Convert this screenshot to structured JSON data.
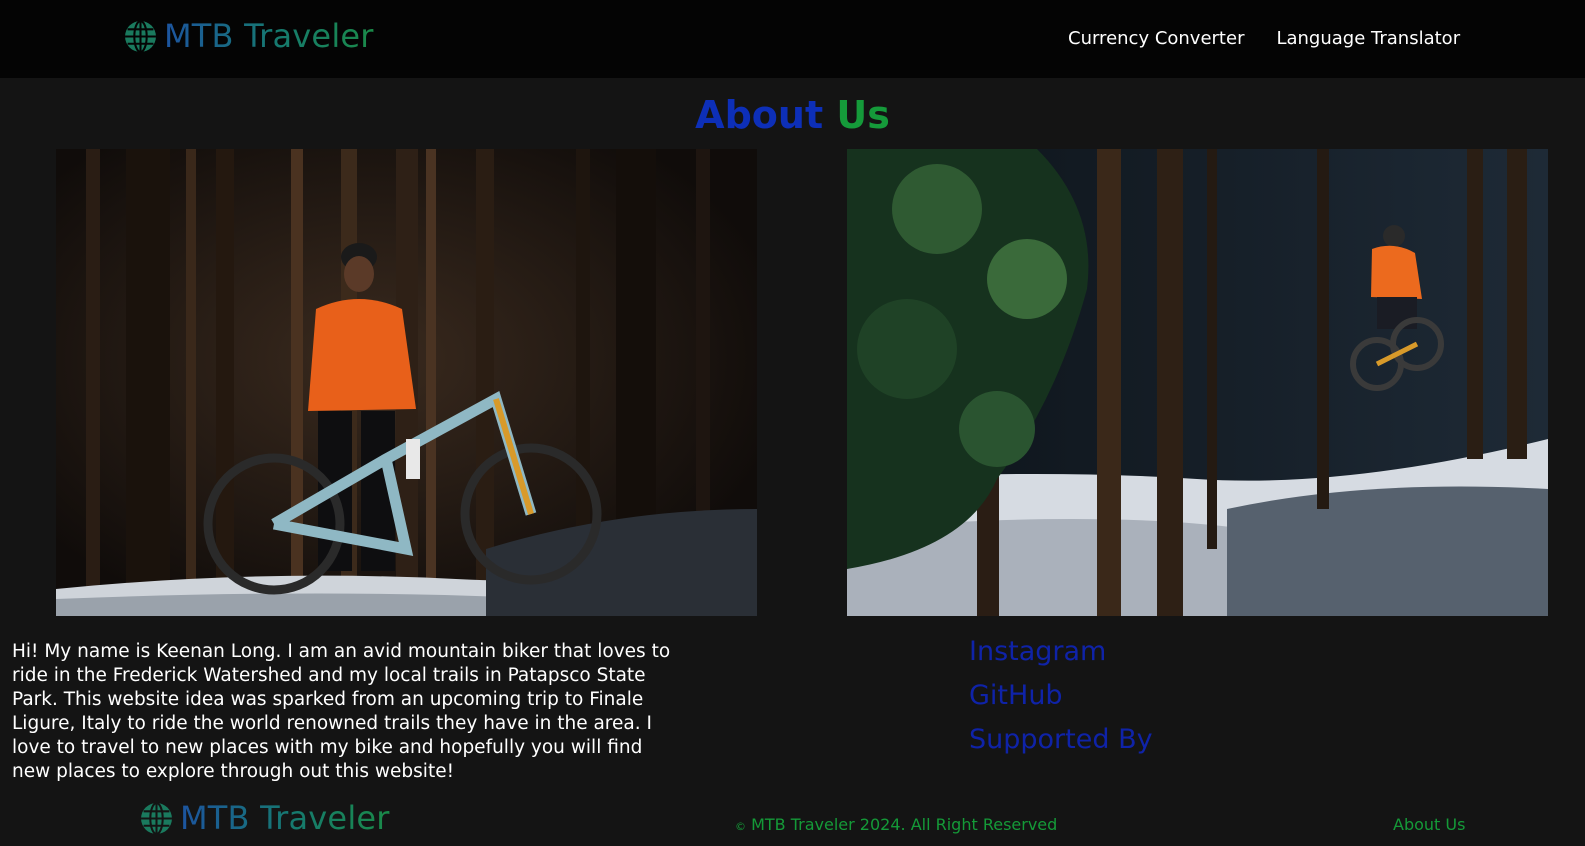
{
  "brand": {
    "name": "MTB Traveler",
    "icon": "globe-icon",
    "gradient": [
      "#1c54a0",
      "#1a8a48"
    ]
  },
  "nav": {
    "items": [
      {
        "label": "Currency Converter"
      },
      {
        "label": "Language Translator"
      }
    ]
  },
  "heading": {
    "part1": "About",
    "part2": "Us",
    "colors": [
      "#0d2fb8",
      "#159a3a"
    ]
  },
  "about": {
    "text": "Hi! My name is Keenan Long. I am an avid mountain biker that loves to ride in the Frederick Watershed and my local trails in Patapsco State Park. This website idea was sparked from an upcoming trip to Finale Ligure, Italy to ride the world renowned trails they have in the area. I love to travel to new places with my bike and hopefully you will find new places to explore through out this website!"
  },
  "social": {
    "links": [
      {
        "label": "Instagram"
      },
      {
        "label": "GitHub"
      },
      {
        "label": "Supported By"
      }
    ],
    "color": "#0f23a8"
  },
  "footer": {
    "copyright_symbol": "©",
    "copyright": "MTB Traveler 2024. All Right Reserved",
    "about_link": "About Us",
    "color": "#149a38"
  },
  "colors": {
    "page_bg": "#141414",
    "navbar_bg": "#040404"
  }
}
